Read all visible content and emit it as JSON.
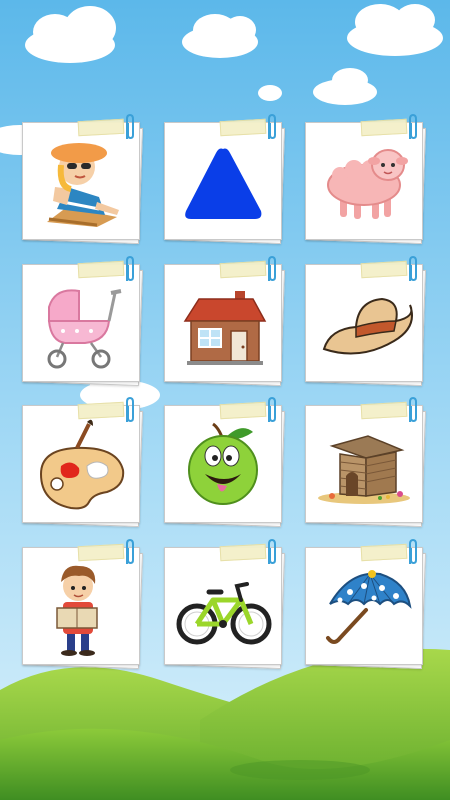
{
  "scene": {
    "sky_color": "#7ec9ee",
    "hill_colors": [
      "#7fc43b",
      "#5aa52c",
      "#a6d64a"
    ]
  },
  "cards": [
    {
      "name": "sunbathing-girl",
      "icon": "sunbathing-girl-icon"
    },
    {
      "name": "triangle",
      "icon": "blue-triangle-icon"
    },
    {
      "name": "sheep",
      "icon": "sheep-icon"
    },
    {
      "name": "baby-stroller",
      "icon": "stroller-icon"
    },
    {
      "name": "house",
      "icon": "house-icon"
    },
    {
      "name": "hat",
      "icon": "hat-icon"
    },
    {
      "name": "paint-palette",
      "icon": "palette-icon"
    },
    {
      "name": "apple",
      "icon": "apple-face-icon"
    },
    {
      "name": "shed",
      "icon": "shed-icon"
    },
    {
      "name": "boy-reading",
      "icon": "boy-reading-icon"
    },
    {
      "name": "bicycle",
      "icon": "bicycle-icon"
    },
    {
      "name": "umbrella",
      "icon": "umbrella-icon"
    }
  ]
}
